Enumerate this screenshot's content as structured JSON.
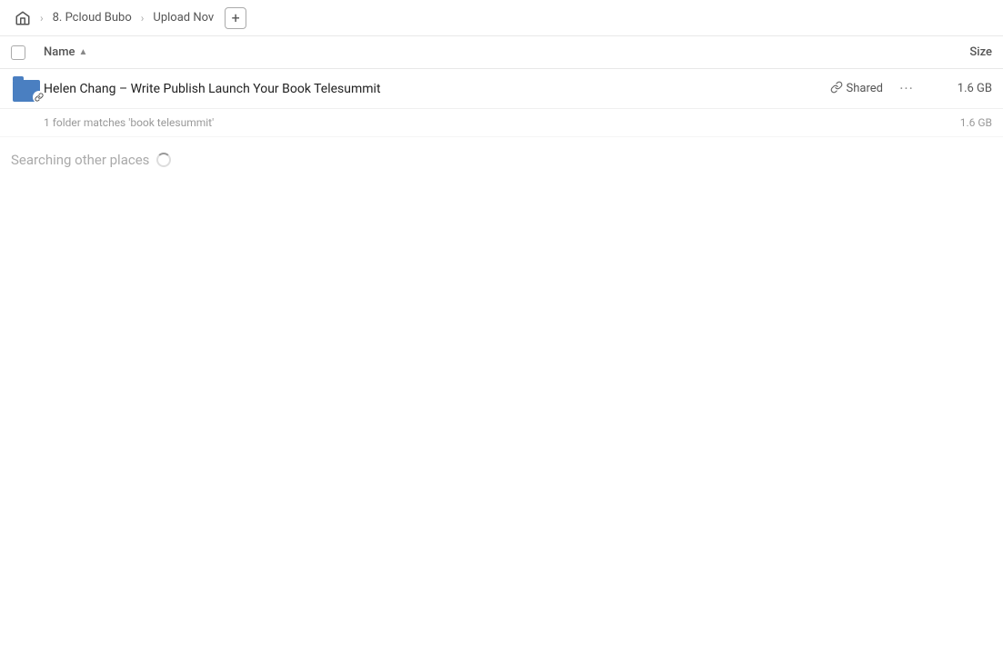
{
  "breadcrumb": {
    "home_label": "Home",
    "items": [
      {
        "label": "8. Pcloud Bubo"
      },
      {
        "label": "Upload Nov"
      }
    ],
    "add_label": "+"
  },
  "columns": {
    "name_label": "Name",
    "size_label": "Size"
  },
  "file_row": {
    "name": "Helen Chang – Write Publish Launch Your Book Telesummit",
    "shared_label": "Shared",
    "size": "1.6 GB",
    "more_label": "···"
  },
  "match_info": {
    "text": "1 folder matches 'book telesummit'",
    "size": "1.6 GB"
  },
  "searching": {
    "label": "Searching other places"
  }
}
